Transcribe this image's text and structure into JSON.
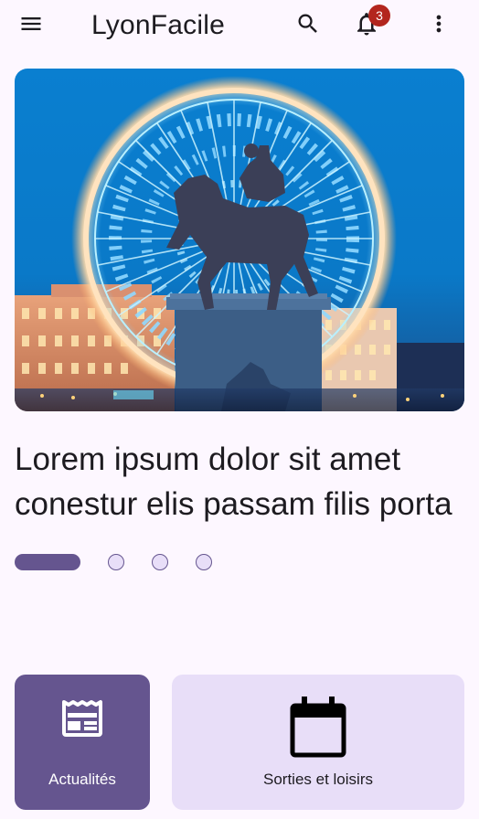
{
  "app_bar": {
    "title": "LyonFacile",
    "menu_icon": "hamburger-menu-icon",
    "search_icon": "search-icon",
    "notifications_icon": "bell-icon",
    "notification_count": "3",
    "more_icon": "more-vertical-icon"
  },
  "hero": {
    "image": "photo of Louis XIV equestrian statue in front of illuminated Ferris wheel at dusk",
    "headline_line1": "Lorem ipsum dolor sit amet",
    "headline_line2": "conestur elis passam filis porta"
  },
  "pager": {
    "total": 4,
    "active_index": 0
  },
  "tiles": [
    {
      "label": "Actualités",
      "icon": "newspaper-icon"
    },
    {
      "label": "Sorties et loisirs",
      "icon": "calendar-icon"
    }
  ],
  "colors": {
    "background": "#fdf7ff",
    "primary": "#65558f",
    "primary_container": "#e8def8",
    "badge": "#b3261e",
    "on_surface": "#1d1b20"
  }
}
